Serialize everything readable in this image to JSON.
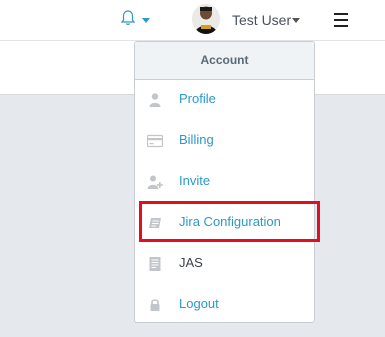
{
  "header": {
    "user_name": "Test User"
  },
  "account_menu": {
    "heading": "Account",
    "items": [
      {
        "label": "Profile",
        "icon": "user-icon"
      },
      {
        "label": "Billing",
        "icon": "credit-card-icon"
      },
      {
        "label": "Invite",
        "icon": "user-plus-icon"
      },
      {
        "label": "Jira Configuration",
        "icon": "jira-icon"
      },
      {
        "label": "JAS",
        "icon": "document-icon"
      },
      {
        "label": "Logout",
        "icon": "lock-icon"
      }
    ]
  },
  "colors": {
    "link": "#2b9ac6",
    "highlight": "#e01020",
    "content_bg": "#e5e8ec"
  }
}
